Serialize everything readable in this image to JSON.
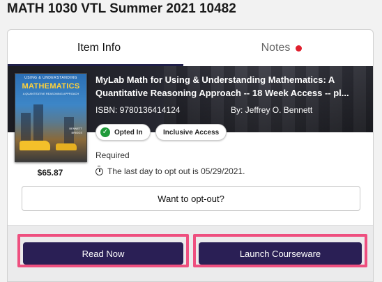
{
  "course": {
    "title": "MATH 1030 VTL Summer 2021 10482"
  },
  "tabs": [
    {
      "label": "Item Info",
      "active": true
    },
    {
      "label": "Notes",
      "active": false,
      "has_notification": true
    }
  ],
  "product": {
    "title": "MyLab Math for Using & Understanding Mathematics: A Quantitative Reasoning Approach -- 18 Week Access -- pl...",
    "isbn": "ISBN: 9780136414124",
    "author": "By: Jeffrey O. Bennett",
    "price": "$65.87",
    "cover": {
      "top_text": "USING & UNDERSTANDING",
      "main_text": "MATHEMATICS",
      "sub_text": "A QUANTITATIVE REASONING APPROACH",
      "authors_line1": "BENNETT",
      "authors_line2": "BRIGGS"
    }
  },
  "badges": {
    "opted_in": "Opted In",
    "inclusive_access": "Inclusive Access"
  },
  "status": {
    "required": "Required",
    "deadline": "The last day to opt out is 05/29/2021."
  },
  "buttons": {
    "opt_out": "Want to opt-out?",
    "read_now": "Read Now",
    "launch_courseware": "Launch Courseware"
  },
  "colors": {
    "primary_button": "#2a1f55",
    "highlight_border": "#ee4f7f",
    "notification_dot": "#e0202e",
    "opted_in_check": "#1f9a3a"
  }
}
